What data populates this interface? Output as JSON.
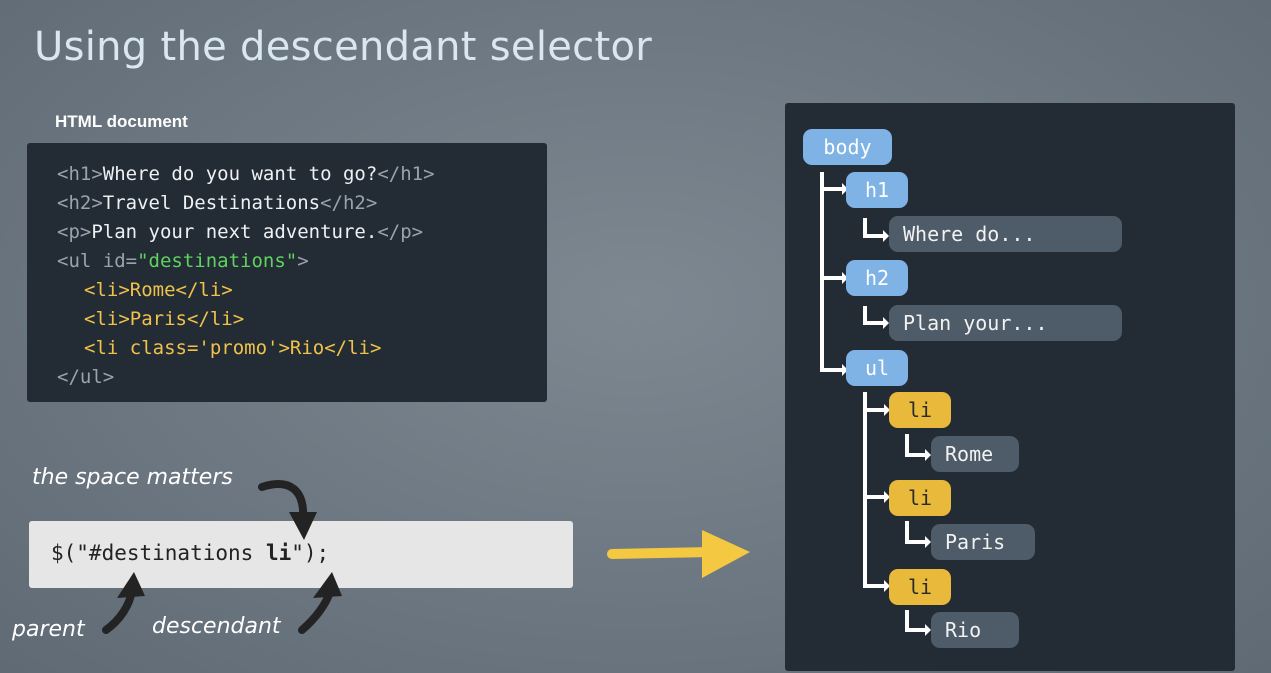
{
  "slide": {
    "title": "Using the descendant selector",
    "doc_label": "HTML document"
  },
  "code": {
    "l1": {
      "open": "<h1>",
      "text": "Where do you want to go?",
      "close": "</h1>"
    },
    "l2": {
      "open": "<h2>",
      "text": "Travel Destinations",
      "close": "</h2>"
    },
    "l3": {
      "open": "<p>",
      "text": "Plan your next adventure.",
      "close": "</p>"
    },
    "l4": {
      "open": "<ul id=",
      "attr": "\"destinations\"",
      "close": ">"
    },
    "l5": {
      "open": "<li>",
      "text": "Rome",
      "close": "</li>"
    },
    "l6": {
      "open": "<li>",
      "text": "Paris",
      "close": "</li>"
    },
    "l7": {
      "open": "<li class='promo'>",
      "text": "Rio",
      "close": "</li>"
    },
    "l8": {
      "close": "</ul>"
    }
  },
  "selector": {
    "before": "$(\"#destinations ",
    "bold": "li",
    "after": "\");"
  },
  "annotations": {
    "space": "the space matters",
    "parent": "parent",
    "descendant": "descendant"
  },
  "tree": {
    "body": "body",
    "h1": "h1",
    "h1_text": "Where do...",
    "h2": "h2",
    "h2_text": "Plan your...",
    "ul": "ul",
    "li1": "li",
    "li1_text": "Rome",
    "li2": "li",
    "li2_text": "Paris",
    "li3": "li",
    "li3_text": "Rio"
  },
  "colors": {
    "accent_gold": "#f0c24a",
    "node_blue": "#7fb2e5",
    "panel_dark": "#232b35"
  }
}
